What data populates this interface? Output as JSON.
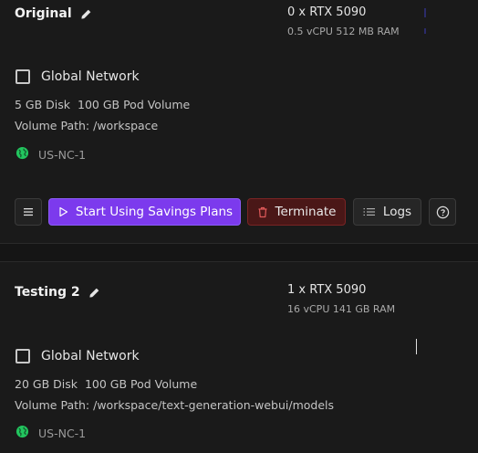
{
  "pods": [
    {
      "name": "Original",
      "gpu": "0 x RTX 5090",
      "specs": "0.5 vCPU 512 MB RAM",
      "network_label": "Global Network",
      "disk": "5 GB Disk",
      "pod_volume": "100 GB Pod Volume",
      "volume_path": "Volume Path: /workspace",
      "region": "US-NC-1",
      "actions": {
        "start_label": "Start Using Savings Plans",
        "terminate_label": "Terminate",
        "logs_label": "Logs"
      }
    },
    {
      "name": "Testing 2",
      "gpu": "1 x RTX 5090",
      "specs": "16 vCPU 141 GB RAM",
      "network_label": "Global Network",
      "disk": "20 GB Disk",
      "pod_volume": "100 GB Pod Volume",
      "volume_path": "Volume Path: /workspace/text-generation-webui/models",
      "region": "US-NC-1"
    }
  ],
  "colors": {
    "background": "#1a1a1a",
    "accent_purple": "#7c3aed",
    "danger": "#4a1717",
    "region_globe": "#22c55e"
  },
  "icons": [
    "pencil-icon",
    "globe-icon",
    "menu-icon",
    "play-icon",
    "trash-icon",
    "logs-icon",
    "help-icon"
  ]
}
